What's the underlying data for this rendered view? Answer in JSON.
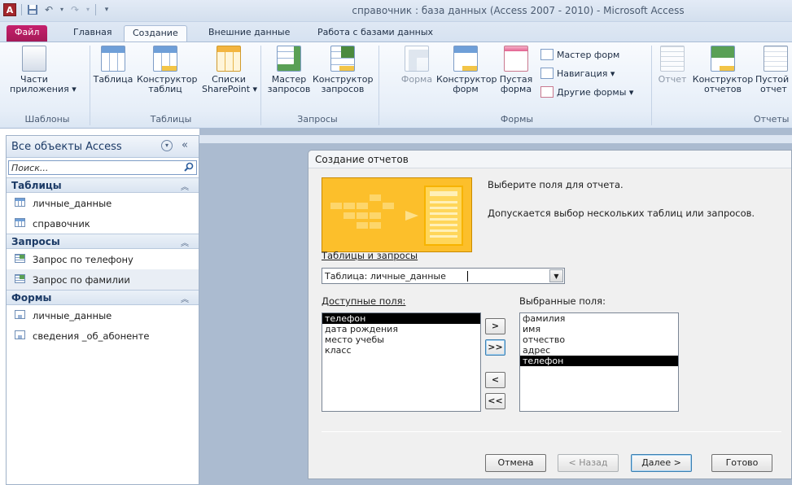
{
  "window": {
    "title": "справочник : база данных (Access 2007 - 2010)  -  Microsoft Access",
    "app_letter": "A"
  },
  "tabs": [
    {
      "label": "Файл"
    },
    {
      "label": "Главная"
    },
    {
      "label": "Создание"
    },
    {
      "label": "Внешние данные"
    },
    {
      "label": "Работа с базами данных"
    }
  ],
  "ribbon": {
    "buttons": {
      "app_parts": [
        "Части",
        "приложения ▾"
      ],
      "table": [
        "Таблица",
        ""
      ],
      "table_design": [
        "Конструктор",
        "таблиц"
      ],
      "sharepoint": [
        "Списки",
        "SharePoint ▾"
      ],
      "query_wizard": [
        "Мастер",
        "запросов"
      ],
      "query_design": [
        "Конструктор",
        "запросов"
      ],
      "form": [
        "Форма",
        ""
      ],
      "form_design": [
        "Конструктор",
        "форм"
      ],
      "blank_form": [
        "Пустая",
        "форма"
      ],
      "report": [
        "Отчет",
        ""
      ],
      "report_design": [
        "Конструктор",
        "отчетов"
      ],
      "blank_report": [
        "Пустой",
        "отчет"
      ]
    },
    "form_small": {
      "form_wizard": "Мастер форм",
      "navigation": "Навигация ▾",
      "more_forms": "Другие формы ▾"
    },
    "groups": {
      "templates": "Шаблоны",
      "tables": "Таблицы",
      "queries": "Запросы",
      "forms": "Формы",
      "reports": "Отчеты"
    }
  },
  "nav": {
    "title": "Все объекты Access",
    "collapse": "«",
    "search_placeholder": "Поиск...",
    "categories": {
      "tables": "Таблицы",
      "queries": "Запросы",
      "forms": "Формы"
    },
    "tables": [
      "личные_данные",
      "справочник"
    ],
    "queries": [
      "Запрос по телефону",
      "Запрос по фамилии"
    ],
    "forms": [
      "личные_данные",
      "сведения _об_абоненте"
    ]
  },
  "dialog": {
    "title": "Создание отчетов",
    "prompt1": "Выберите поля для отчета.",
    "prompt2": "Допускается выбор нескольких таблиц или запросов.",
    "tables_label": "Таблицы и запросы",
    "combo_value": "Таблица: личные_данные",
    "available_label": "Доступные поля:",
    "selected_label": "Выбранные поля:",
    "available_fields": [
      "телефон",
      "дата рождения",
      "место учебы",
      "класс"
    ],
    "selected_fields": [
      "фамилия",
      "имя",
      "отчество",
      "адрес",
      "телефон"
    ],
    "available_selected": "телефон",
    "selected_selected": "телефон",
    "move_buttons": {
      "one": ">",
      "all": ">>",
      "back_one": "<",
      "back_all": "<<"
    },
    "buttons": {
      "cancel": "Отмена",
      "back": "< Назад",
      "next": "Далее >",
      "finish": "Готово"
    }
  }
}
